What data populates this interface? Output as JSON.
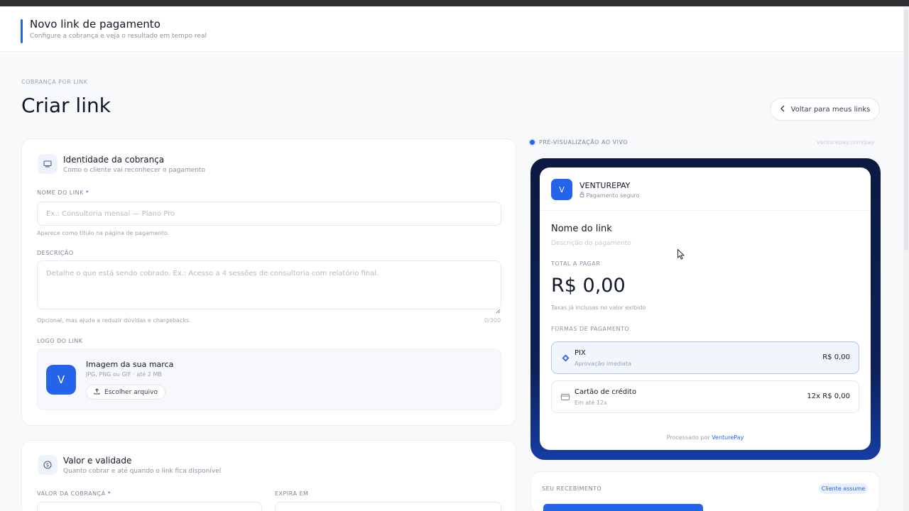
{
  "header": {
    "title": "Novo link de pagamento",
    "subtitle": "Configure a cobrança e veja o resultado em tempo real"
  },
  "page": {
    "eyebrow": "COBRANÇA POR LINK",
    "title": "Criar link",
    "back_label": "Voltar para meus links"
  },
  "identity": {
    "title": "Identidade da cobrança",
    "subtitle": "Como o cliente vai reconhecer o pagamento",
    "name_label": "NOME DO LINK",
    "required_mark": "*",
    "name_placeholder": "Ex.: Consultoria mensal — Plano Pro",
    "name_help": "Aparece como título na página de pagamento.",
    "desc_label": "DESCRIÇÃO",
    "desc_placeholder": "Detalhe o que está sendo cobrado. Ex.: Acesso a 4 sessões de consultoria com relatório final.",
    "desc_help": "Opcional, mas ajuda a reduzir dúvidas e chargebacks.",
    "desc_counter": "0/300",
    "logo_label": "LOGO DO LINK",
    "logo_initial": "V",
    "logo_title": "Imagem da sua marca",
    "logo_formats": "JPG, PNG ou GIF · até 2 MB",
    "logo_button": "Escolher arquivo"
  },
  "value": {
    "title": "Valor e validade",
    "subtitle": "Quanto cobrar e até quando o link fica disponível",
    "amount_label": "VALOR DA COBRANÇA",
    "required_mark": "*",
    "expires_label": "EXPIRA EM"
  },
  "preview": {
    "live_label": "PRÉ-VISUALIZAÇÃO AO VIVO",
    "url": "venturepay.com/pay",
    "brand": "VENTUREPAY",
    "brand_initial": "V",
    "secure": "Pagamento seguro",
    "link_name": "Nome do link",
    "description": "Descrição do pagamento",
    "total_label": "TOTAL A PAGAR",
    "amount": "R$ 0,00",
    "tax_note": "Taxas já inclusas no valor exibido",
    "forms_label": "FORMAS DE PAGAMENTO",
    "methods": [
      {
        "name": "PIX",
        "sub": "Aprovação imediata",
        "value": "R$ 0,00"
      },
      {
        "name": "Cartão de crédito",
        "sub": "Em até 12x",
        "value": "12x R$ 0,00"
      }
    ],
    "footer_prefix": "Processado por",
    "footer_brand": "VenturePay"
  },
  "receipt": {
    "label": "SEU RECEBIMENTO",
    "badge": "Cliente assume"
  },
  "colors": {
    "accent": "#2563eb",
    "frame": "#0b1a40"
  }
}
